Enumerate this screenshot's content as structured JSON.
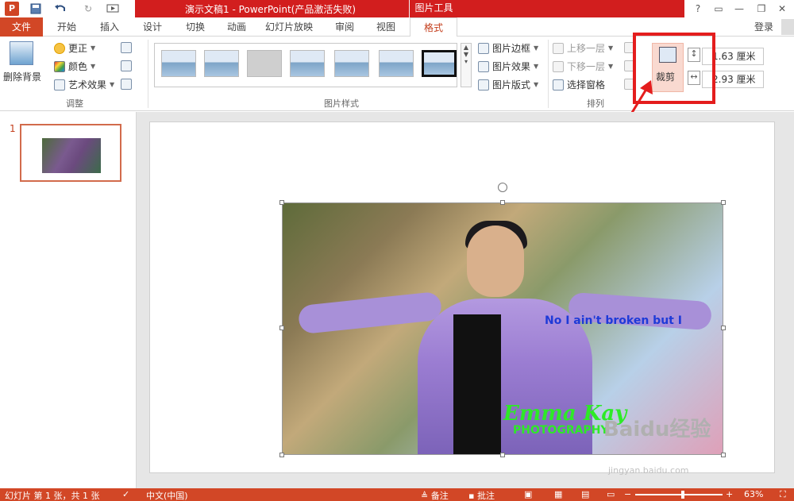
{
  "app": {
    "title": "演示文稿1 - PowerPoint(产品激活失败)",
    "context_tool_group": "图片工具",
    "login": "登录"
  },
  "quick_access": {
    "help": "?"
  },
  "tabs": [
    {
      "label": "文件",
      "active": false
    },
    {
      "label": "开始",
      "active": false
    },
    {
      "label": "插入",
      "active": false
    },
    {
      "label": "设计",
      "active": false
    },
    {
      "label": "切换",
      "active": false
    },
    {
      "label": "动画",
      "active": false
    },
    {
      "label": "幻灯片放映",
      "active": false
    },
    {
      "label": "审阅",
      "active": false
    },
    {
      "label": "视图",
      "active": false
    },
    {
      "label": "格式",
      "active": true
    }
  ],
  "ribbon": {
    "remove_bg": "删除背景",
    "adjust": {
      "corrections": "更正",
      "color": "颜色",
      "artistic": "艺术效果",
      "group_label": "调整"
    },
    "picture_styles": {
      "border": "图片边框",
      "effects": "图片效果",
      "layout": "图片版式",
      "group_label": "图片样式"
    },
    "arrange": {
      "bring_forward": "上移一层",
      "send_backward": "下移一层",
      "selection_pane": "选择窗格",
      "group_label": "排列"
    },
    "size": {
      "crop": "裁剪",
      "height_value": "1.63 厘米",
      "width_value": "2.93 厘米"
    }
  },
  "slides_pane": {
    "slide_number": "1"
  },
  "slide_content": {
    "photo_text_1": "No I ain't broken but I",
    "photo_text_2": "Emma Kay",
    "photo_text_3": "PHOTOGRAPHY",
    "watermark": "Baidu经验",
    "watermark_sub": "jingyan.baidu.com"
  },
  "statusbar": {
    "slide_info": "幻灯片 第 1 张，共 1 张",
    "language": "中文(中国)",
    "notes": "备注",
    "comments": "批注",
    "zoom": "63%"
  },
  "colors": {
    "accent": "#d24726",
    "title_red": "#d21e1e",
    "highlight": "#e41d1d"
  }
}
